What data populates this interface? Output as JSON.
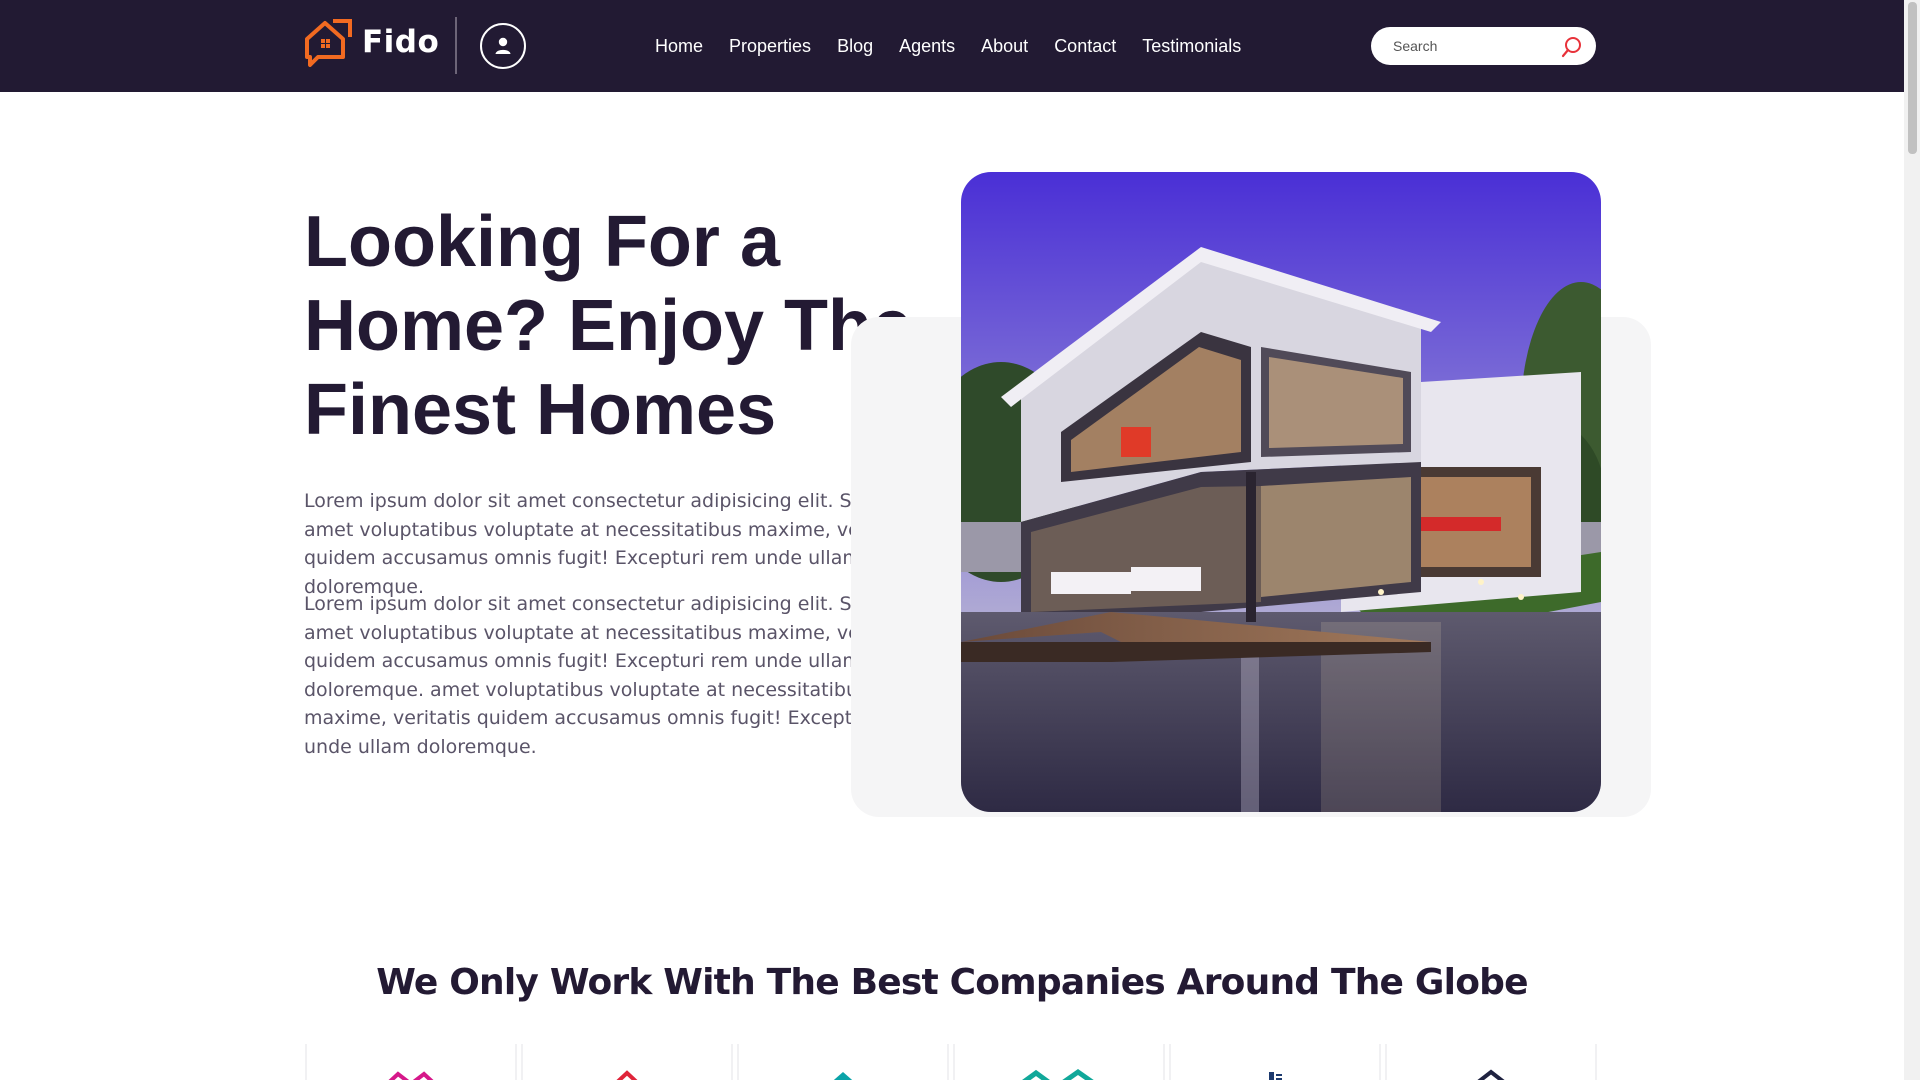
{
  "header": {
    "brand": "Fido",
    "nav": [
      "Home",
      "Properties",
      "Blog",
      "Agents",
      "About",
      "Contact",
      "Testimonials"
    ],
    "search": {
      "placeholder": "Search",
      "value": ""
    }
  },
  "hero": {
    "title": "Looking For a Home? Enjoy The Finest Homes",
    "paragraph1": "Lorem ipsum dolor sit amet consectetur adipisicing elit. Sapiente amet voluptatibus voluptate at necessitatibus maxime, veritatis quidem accusamus omnis fugit! Excepturi rem unde ullam doloremque.",
    "paragraph2": "Lorem ipsum dolor sit amet consectetur adipisicing elit. Sapiente amet voluptatibus voluptate at necessitatibus maxime, veritatis quidem accusamus omnis fugit! Excepturi rem unde ullam doloremque. amet voluptatibus voluptate at necessitatibus maxime, veritatis quidem accusamus omnis fugit! Excepturi rem unde ullam doloremque."
  },
  "partners": {
    "title": "We Only Work With The Best Companies Around The Globe",
    "logos": [
      {
        "icon": "magenta-roof-logo-icon",
        "color": "#d6188a"
      },
      {
        "icon": "red-roof-logo-icon",
        "color": "#e0243a"
      },
      {
        "icon": "teal-house-logo-icon",
        "color": "#0aa3a8"
      },
      {
        "icon": "green-double-roof-logo-icon",
        "color": "#11a89a"
      },
      {
        "icon": "navy-building-logo-icon",
        "color": "#1d3a6e"
      },
      {
        "icon": "dark-roof-logo-icon",
        "color": "#1f2240"
      }
    ]
  },
  "colors": {
    "header_bg": "#221a33",
    "brand_orange": "#f26a21",
    "search_icon": "#e8323a"
  }
}
